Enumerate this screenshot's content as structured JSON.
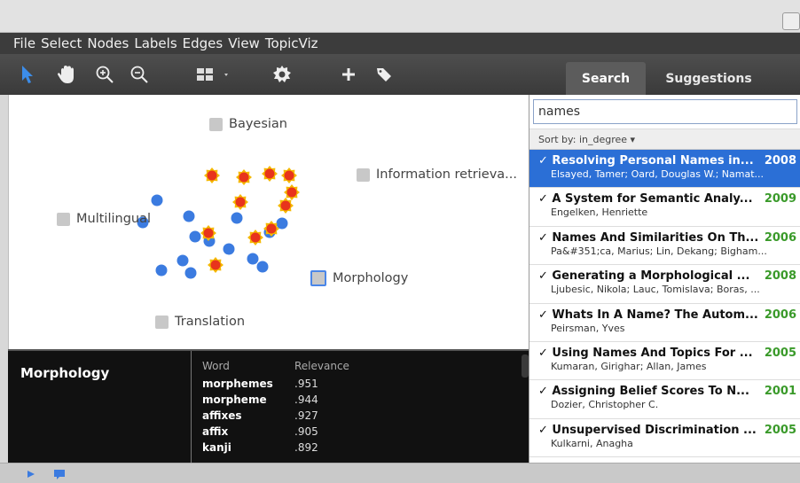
{
  "menubar": {
    "items": [
      "File",
      "Select",
      "Nodes",
      "Labels",
      "Edges",
      "View",
      "TopicViz"
    ]
  },
  "toolbar": {
    "tools": [
      {
        "name": "select-pointer-icon"
      },
      {
        "name": "hand-pan-icon"
      },
      {
        "name": "zoom-in-icon"
      },
      {
        "name": "zoom-out-icon"
      },
      {
        "name": "layout-grid-icon"
      },
      {
        "name": "settings-gear-icon"
      },
      {
        "name": "add-plus-icon"
      },
      {
        "name": "tag-icon"
      }
    ]
  },
  "tabs": {
    "search": "Search",
    "suggestions": "Suggestions"
  },
  "graph": {
    "topics": {
      "bayesian": "Bayesian",
      "information_retrieval": "Information retrieva...",
      "multilingual": "Multilingual",
      "morphology": "Morphology",
      "translation": "Translation"
    },
    "colors": {
      "blue_node": "#3b7be0",
      "highlight_node": "#e8341c",
      "highlight_ring": "#f5b800"
    }
  },
  "topic_panel": {
    "title": "Morphology",
    "header_word": "Word",
    "header_relevance": "Relevance",
    "rows": [
      {
        "word": "morphemes",
        "relevance": ".951"
      },
      {
        "word": "morpheme",
        "relevance": ".944"
      },
      {
        "word": "affixes",
        "relevance": ".927"
      },
      {
        "word": "affix",
        "relevance": ".905"
      },
      {
        "word": "kanji",
        "relevance": ".892"
      }
    ]
  },
  "search": {
    "query": "names",
    "sort_label": "Sort by: in_degree ▾"
  },
  "results": [
    {
      "title": "✓ Resolving Personal Names in...",
      "year": "2008",
      "authors": "Elsayed, Tamer; Oard, Douglas W.; Namat...",
      "selected": true
    },
    {
      "title": "✓ A System for Semantic Analy...",
      "year": "2009",
      "authors": "Engelken, Henriette",
      "selected": false
    },
    {
      "title": "✓ Names And Similarities On Th...",
      "year": "2006",
      "authors": "Pa&#351;ca, Marius; Lin, Dekang; Bigham...",
      "selected": false
    },
    {
      "title": "✓ Generating a Morphological ...",
      "year": "2008",
      "authors": "Ljubesic, Nikola; Lauc, Tomislava; Boras, ...",
      "selected": false
    },
    {
      "title": "✓ Whats In A Name? The Autom...",
      "year": "2006",
      "authors": "Peirsman, Yves",
      "selected": false
    },
    {
      "title": "✓ Using Names And Topics For ...",
      "year": "2005",
      "authors": "Kumaran, Girighar; Allan, James",
      "selected": false
    },
    {
      "title": "✓ Assigning Belief Scores To N...",
      "year": "2001",
      "authors": "Dozier, Christopher C.",
      "selected": false
    },
    {
      "title": "✓ Unsupervised Discrimination ...",
      "year": "2005",
      "authors": "Kulkarni, Anagha",
      "selected": false
    }
  ]
}
